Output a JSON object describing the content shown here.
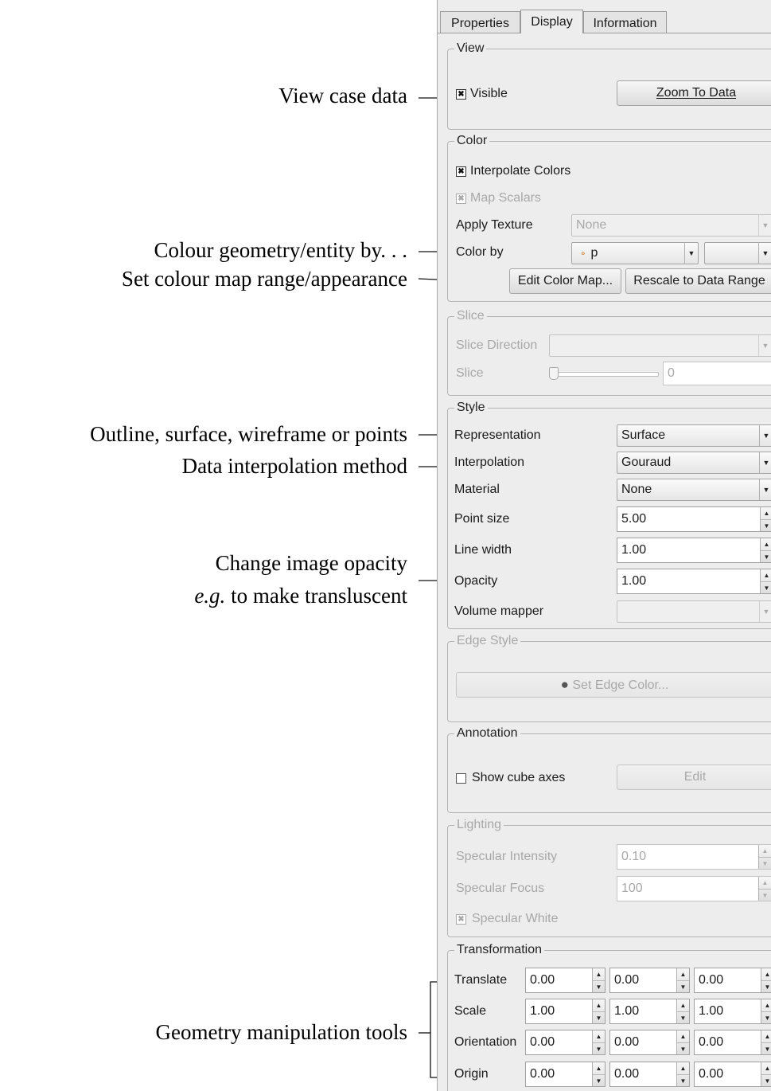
{
  "annotations": {
    "view_case": "View case data",
    "colour_by": "Colour geometry/entity by. . .",
    "colour_map": "Set colour map range/appearance",
    "representation": "Outline, surface, wireframe or points",
    "interpolation": "Data interpolation method",
    "opacity_line1": "Change image opacity",
    "opacity_line2_em": "e.g.",
    "opacity_line2_rest": " to make transluscent",
    "geometry": "Geometry manipulation tools"
  },
  "tabs": [
    "Properties",
    "Display",
    "Information"
  ],
  "active_tab": "Display",
  "view": {
    "title": "View",
    "visible_label": "Visible",
    "visible_checked": true,
    "zoom_button": "Zoom To Data"
  },
  "color": {
    "title": "Color",
    "interpolate_label": "Interpolate Colors",
    "interpolate_checked": true,
    "map_scalars_label": "Map Scalars",
    "map_scalars_checked": true,
    "apply_texture_label": "Apply Texture",
    "apply_texture_value": "None",
    "color_by_label": "Color by",
    "color_by_value": "p",
    "color_by_component": "",
    "edit_color_map_button": "Edit Color Map...",
    "rescale_button": "Rescale to Data Range"
  },
  "slice": {
    "title": "Slice",
    "direction_label": "Slice Direction",
    "direction_value": "",
    "slice_label": "Slice",
    "slice_value": "0"
  },
  "style": {
    "title": "Style",
    "representation_label": "Representation",
    "representation_value": "Surface",
    "interpolation_label": "Interpolation",
    "interpolation_value": "Gouraud",
    "material_label": "Material",
    "material_value": "None",
    "point_size_label": "Point size",
    "point_size_value": "5.00",
    "line_width_label": "Line width",
    "line_width_value": "1.00",
    "opacity_label": "Opacity",
    "opacity_value": "1.00",
    "volume_mapper_label": "Volume mapper",
    "volume_mapper_value": ""
  },
  "edge_style": {
    "title": "Edge Style",
    "set_edge_color_button": "Set Edge Color..."
  },
  "annotation_group": {
    "title": "Annotation",
    "show_cube_axes_label": "Show cube axes",
    "show_cube_axes_checked": false,
    "edit_button": "Edit"
  },
  "lighting": {
    "title": "Lighting",
    "specular_intensity_label": "Specular Intensity",
    "specular_intensity_value": "0.10",
    "specular_focus_label": "Specular Focus",
    "specular_focus_value": "100",
    "specular_white_label": "Specular White",
    "specular_white_checked": true
  },
  "transformation": {
    "title": "Transformation",
    "translate_label": "Translate",
    "translate": [
      "0.00",
      "0.00",
      "0.00"
    ],
    "scale_label": "Scale",
    "scale": [
      "1.00",
      "1.00",
      "1.00"
    ],
    "orientation_label": "Orientation",
    "orientation": [
      "0.00",
      "0.00",
      "0.00"
    ],
    "origin_label": "Origin",
    "origin": [
      "0.00",
      "0.00",
      "0.00"
    ]
  },
  "icons": {
    "checkbox_checked_glyph": "✖",
    "combo_arrow": "▼",
    "spin_up": "▲",
    "spin_down": "▼",
    "color_dot": "●",
    "point_marker": "∘"
  }
}
